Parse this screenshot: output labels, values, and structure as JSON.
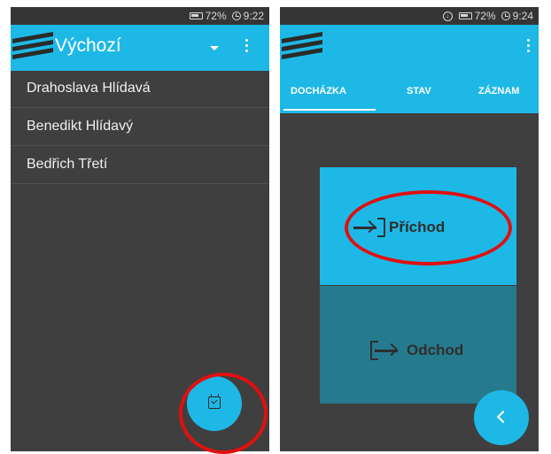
{
  "left_screen": {
    "status": {
      "battery": "72%",
      "time": "9:22"
    },
    "appbar": {
      "title": "Výchozí"
    },
    "people": [
      {
        "name": "Drahoslava Hlídavá"
      },
      {
        "name": "Benedikt Hlídavý"
      },
      {
        "name": "Bedřich Třetí"
      }
    ],
    "fab_icon": "calendar-check-icon"
  },
  "right_screen": {
    "status": {
      "battery": "72%",
      "time": "9:24"
    },
    "tabs": [
      {
        "label": "DOCHÁZKA",
        "active": true
      },
      {
        "label": "STAV",
        "active": false
      },
      {
        "label": "ZÁZNAM",
        "active": false
      }
    ],
    "arrival_label": "Příchod",
    "departure_label": "Odchod",
    "fab_icon": "chevron-left-icon"
  },
  "colors": {
    "accent": "#1eb8e6",
    "background": "#3f3f3f",
    "departure": "#267a8e",
    "highlight": "#e01010"
  }
}
